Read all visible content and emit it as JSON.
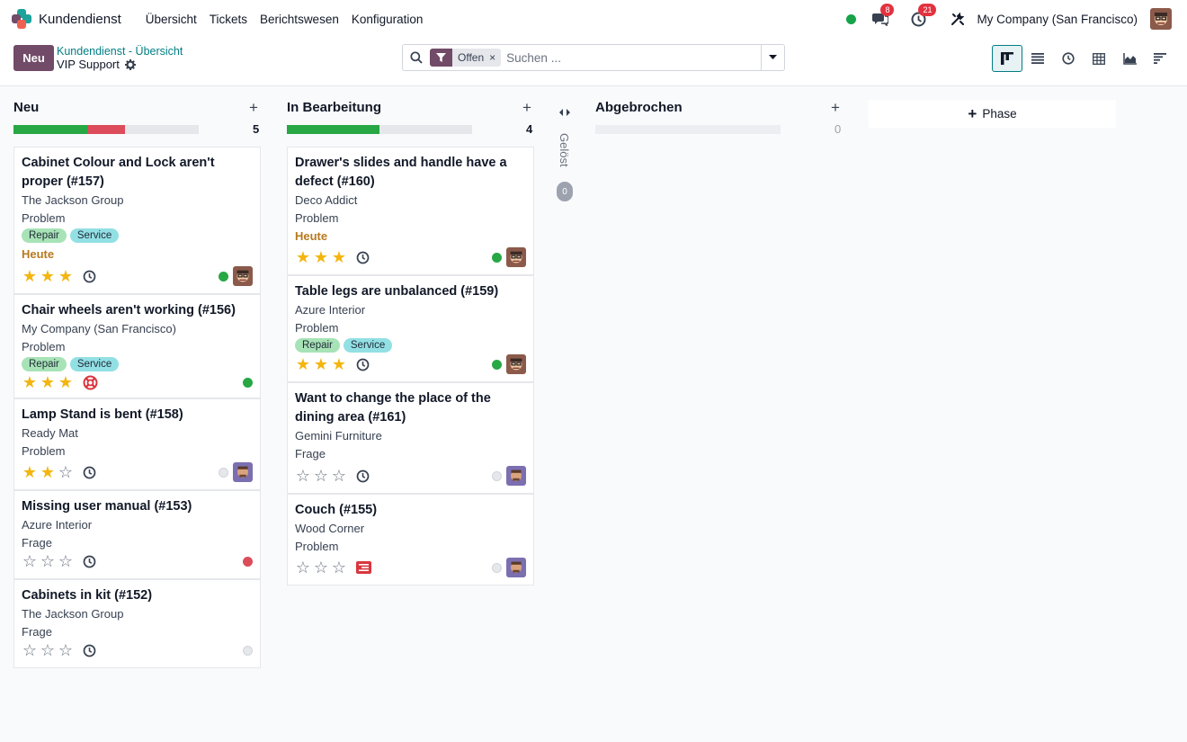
{
  "app": {
    "title": "Kundendienst",
    "menu": [
      "Übersicht",
      "Tickets",
      "Berichtswesen",
      "Konfiguration"
    ],
    "messages_badge": "8",
    "activities_badge": "21",
    "company": "My Company (San Francisco)"
  },
  "control": {
    "new_label": "Neu",
    "breadcrumb_parent": "Kundendienst - Übersicht",
    "breadcrumb_current": "VIP Support",
    "facet_label": "Offen",
    "facet_close": "×",
    "search_placeholder": "Suchen ..."
  },
  "kanban": {
    "columns": [
      {
        "title": "Neu",
        "count": "5",
        "progress": [
          {
            "color": "#28a745",
            "fraction": 0.4
          },
          {
            "color": "#dc4c5a",
            "fraction": 0.2
          }
        ],
        "cards": [
          {
            "title": "Cabinet Colour and Lock aren't proper (#157)",
            "customer": "The Jackson Group",
            "type": "Problem",
            "tags": [
              "Repair",
              "Service"
            ],
            "date": "Heute",
            "stars": 3,
            "activity": "clock",
            "state": "green",
            "avatar": "person-a"
          },
          {
            "title": "Chair wheels aren't working (#156)",
            "customer": "My Company (San Francisco)",
            "type": "Problem",
            "tags": [
              "Repair",
              "Service"
            ],
            "date": "",
            "stars": 3,
            "activity": "lifebuoy",
            "state": "green",
            "avatar": ""
          },
          {
            "title": "Lamp Stand is bent (#158)",
            "customer": "Ready Mat",
            "type": "Problem",
            "tags": [],
            "date": "",
            "stars": 2,
            "activity": "clock",
            "state": "grey",
            "avatar": "person-b"
          },
          {
            "title": "Missing user manual (#153)",
            "customer": "Azure Interior",
            "type": "Frage",
            "tags": [],
            "date": "",
            "stars": 0,
            "activity": "clock",
            "state": "red",
            "avatar": ""
          },
          {
            "title": "Cabinets in kit (#152)",
            "customer": "The Jackson Group",
            "type": "Frage",
            "tags": [],
            "date": "",
            "stars": 0,
            "activity": "clock",
            "state": "grey",
            "avatar": ""
          }
        ]
      },
      {
        "title": "In Bearbeitung",
        "count": "4",
        "progress": [
          {
            "color": "#28a745",
            "fraction": 0.5
          }
        ],
        "cards": [
          {
            "title": "Drawer's slides and handle have a defect (#160)",
            "customer": "Deco Addict",
            "type": "Problem",
            "tags": [],
            "date": "Heute",
            "stars": 3,
            "activity": "clock",
            "state": "green",
            "avatar": "person-a"
          },
          {
            "title": "Table legs are unbalanced (#159)",
            "customer": "Azure Interior",
            "type": "Problem",
            "tags": [
              "Repair",
              "Service"
            ],
            "date": "",
            "stars": 3,
            "activity": "clock",
            "state": "green",
            "avatar": "person-a"
          },
          {
            "title": "Want to change the place of the dining area (#161)",
            "customer": "Gemini Furniture",
            "type": "Frage",
            "tags": [],
            "date": "",
            "stars": 0,
            "activity": "clock",
            "state": "grey",
            "avatar": "person-b"
          },
          {
            "title": "Couch (#155)",
            "customer": "Wood Corner",
            "type": "Problem",
            "tags": [],
            "date": "",
            "stars": 0,
            "activity": "list",
            "state": "grey",
            "avatar": "person-b"
          }
        ]
      },
      {
        "title": "Abgebrochen",
        "count": "0",
        "progress": [],
        "cards": []
      }
    ],
    "folded": {
      "title": "Gelöst",
      "count": "0"
    },
    "add_phase": "Phase"
  },
  "colors": {
    "primary": "#714b67",
    "link": "#017e84",
    "tag_repair": "#a7e3b6",
    "tag_service": "#92e0e4",
    "star": "#f3b50e"
  }
}
